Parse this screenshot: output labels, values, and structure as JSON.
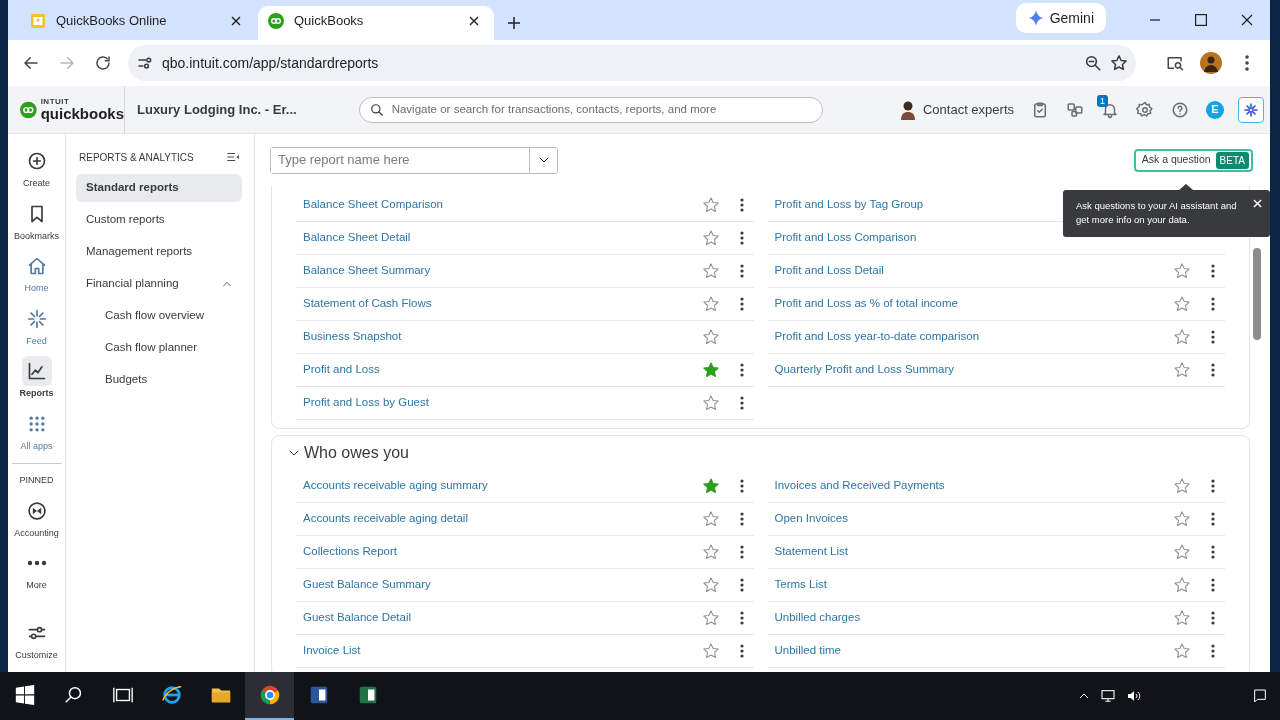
{
  "browser": {
    "tabs": [
      {
        "title": "QuickBooks Online",
        "selected": false
      },
      {
        "title": "QuickBooks",
        "selected": true
      }
    ],
    "gemini": "Gemini",
    "url": "qbo.intuit.com/app/standardreports"
  },
  "header": {
    "logo": {
      "brand": "INTUIT",
      "product": "quickbooks"
    },
    "company": "Luxury Lodging Inc. - Er...",
    "search": {
      "placeholder": "Navigate or search for transactions, contacts, reports, and more"
    },
    "contact": "Contact experts",
    "notifications": "1",
    "avatar": "E"
  },
  "rail": {
    "items": [
      {
        "label": "Create",
        "selected": false
      },
      {
        "label": "Bookmarks",
        "selected": false
      },
      {
        "label": "Home",
        "selected": false
      },
      {
        "label": "Feed",
        "selected": false
      },
      {
        "label": "Reports",
        "selected": true
      },
      {
        "label": "All apps",
        "selected": false
      }
    ],
    "pinned_label": "PINNED",
    "pinned": [
      {
        "label": "Accounting",
        "selected": false
      },
      {
        "label": "More",
        "selected": false
      }
    ],
    "footer": {
      "label": "Customize",
      "selected": false
    }
  },
  "sidebar": {
    "heading": "REPORTS & ANALYTICS",
    "items": [
      {
        "label": "Standard reports",
        "selected": true
      },
      {
        "label": "Custom reports",
        "selected": false
      },
      {
        "label": "Management reports",
        "selected": false
      },
      {
        "label": "Financial planning",
        "selected": false,
        "expanded": true,
        "children": [
          {
            "label": "Cash flow overview",
            "selected": false
          },
          {
            "label": "Cash flow planner",
            "selected": false
          },
          {
            "label": "Budgets",
            "selected": false
          }
        ]
      }
    ]
  },
  "toolbar": {
    "report_search": {
      "placeholder": "Type report name here"
    },
    "ask": {
      "label": "Ask a question",
      "badge": "BETA"
    },
    "tooltip": "Ask questions to your AI assistant and get more info on your data."
  },
  "sections": [
    {
      "left": [
        {
          "name": "Balance Sheet Comparison",
          "favorite": false,
          "menu": true
        },
        {
          "name": "Balance Sheet Detail",
          "favorite": false,
          "menu": true
        },
        {
          "name": "Balance Sheet Summary",
          "favorite": false,
          "menu": true
        },
        {
          "name": "Statement of Cash Flows",
          "favorite": false,
          "menu": true
        },
        {
          "name": "Business Snapshot",
          "favorite": false,
          "menu": false
        },
        {
          "name": "Profit and Loss",
          "favorite": true,
          "menu": true
        },
        {
          "name": "Profit and Loss by Guest",
          "favorite": false,
          "menu": true
        }
      ],
      "right": [
        {
          "name": "Profit and Loss by Tag Group"
        },
        {
          "name": "Profit and Loss Comparison"
        },
        {
          "name": "Profit and Loss Detail",
          "favorite": false,
          "menu": true
        },
        {
          "name": "Profit and Loss as % of total income",
          "favorite": false,
          "menu": true
        },
        {
          "name": "Profit and Loss year-to-date comparison",
          "favorite": false,
          "menu": true
        },
        {
          "name": "Quarterly Profit and Loss Summary",
          "favorite": false,
          "menu": true
        }
      ]
    },
    {
      "title": "Who owes you",
      "expanded": true,
      "left": [
        {
          "name": "Accounts receivable aging summary",
          "favorite": true,
          "menu": true
        },
        {
          "name": "Accounts receivable aging detail",
          "favorite": false,
          "menu": true
        },
        {
          "name": "Collections Report",
          "favorite": false,
          "menu": true
        },
        {
          "name": "Guest Balance Summary",
          "favorite": false,
          "menu": true
        },
        {
          "name": "Guest Balance Detail",
          "favorite": false,
          "menu": true
        },
        {
          "name": "Invoice List",
          "favorite": false,
          "menu": true
        }
      ],
      "right": [
        {
          "name": "Invoices and Received Payments",
          "favorite": false,
          "menu": true
        },
        {
          "name": "Open Invoices",
          "favorite": false,
          "menu": true
        },
        {
          "name": "Statement List",
          "favorite": false,
          "menu": true
        },
        {
          "name": "Terms List",
          "favorite": false,
          "menu": true
        },
        {
          "name": "Unbilled charges",
          "favorite": false,
          "menu": true
        },
        {
          "name": "Unbilled time",
          "favorite": false,
          "menu": true
        }
      ]
    }
  ],
  "taskbar": {
    "apps": [
      {
        "kind": "ie",
        "active": false
      },
      {
        "kind": "folder",
        "active": false
      },
      {
        "kind": "chrome",
        "active": true
      },
      {
        "kind": "word",
        "active": false
      },
      {
        "kind": "excel",
        "active": false
      }
    ]
  }
}
